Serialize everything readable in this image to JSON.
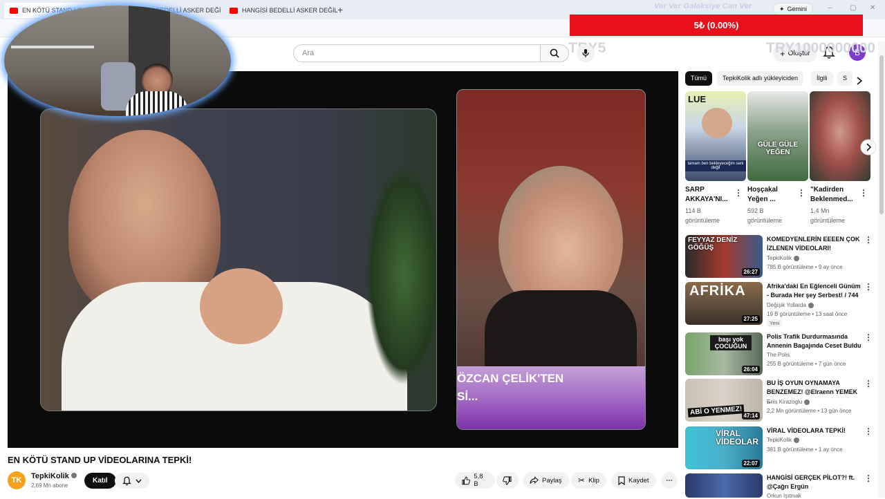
{
  "browser": {
    "tabs": [
      {
        "title": "EN KÖTÜ STAND UP VİDEOLARINA TEPKİ!"
      },
      {
        "title": "HANGİSİ BEDELLİ ASKER DEĞİL"
      },
      {
        "title": "HANGİSİ BEDELLİ ASKER DEĞİL"
      }
    ],
    "new_tab_glyph": "+",
    "gemini_label": "Gemini",
    "window_controls": [
      "–",
      "▢",
      "✕"
    ]
  },
  "stream_overlay": {
    "marquee_text": "Ver Ver Galaksiye Can Ver",
    "donation_bar_text": "5₺ (0.00%)",
    "left_counter": "TRY5",
    "right_counter": "TRY1000000000"
  },
  "header": {
    "search_placeholder": "Ara",
    "create_label": "Oluştur",
    "avatar_initial": "B"
  },
  "player": {
    "caption_line1": "ÖZCAN ÇELİK'TEN",
    "caption_line2": "Sİ..."
  },
  "video": {
    "title": "EN KÖTÜ STAND UP VİDEOLARINA TEPKİ!",
    "channel": "TepkiKolik",
    "channel_logo": "TK",
    "subscribers": "2,69 Mn abone",
    "join_label": "Katıl",
    "likes": "5,8 B",
    "share_label": "Paylaş",
    "clip_label": "Klip",
    "save_label": "Kaydet"
  },
  "sidebar": {
    "chips": [
      "Tümü",
      "TepkiKolik adlı yükleyiciden",
      "İlgili",
      "S"
    ],
    "shorts": [
      {
        "title_l1": "SARP",
        "title_l2": "AKKAYA'NI...",
        "views_l1": "114 B",
        "views_l2": "görüntüleme",
        "thumb_text": "tamam ben bekleyeceğim seni değil",
        "thumb_logo": "LUE"
      },
      {
        "title_l1": "Hoşçakal",
        "title_l2": "Yeğen ...",
        "views_l1": "592 B",
        "views_l2": "görüntüleme",
        "thumb_text": "GÜLE GÜLE YEĞEN"
      },
      {
        "title_l1": "\"Kadirden",
        "title_l2": "Beklenmed...",
        "views_l1": "1,4 Mn",
        "views_l2": "görüntüleme"
      }
    ],
    "videos": [
      {
        "title": "KOMEDYENLERİN EEEEN ÇOK İZLENEN VİDEOLARI!",
        "channel": "TepkiKolik",
        "meta": "785 B görüntüleme • 9 ay önce",
        "duration": "26:27",
        "thumb_text": "FEYYAZ DENİZ GÖĞÜŞ",
        "badge": ""
      },
      {
        "title": "Afrika'daki En Eğlenceli Günüm - Burada Her şey Serbest! / 744",
        "channel": "Değişik Yollarda",
        "meta": "19 B görüntüleme • 13 saat önce",
        "duration": "27:25",
        "thumb_text": "AFRİKA",
        "badge": "Yeni"
      },
      {
        "title": "Polis Trafik Durdurmasında Annenin Bagajında Ceset Buldu",
        "channel": "The Polis",
        "meta": "255 B görüntüleme • 7 gün önce",
        "duration": "26:04",
        "thumb_text": "başı yok ÇOCUĞUN",
        "badge": ""
      },
      {
        "title": "BU İŞ OYUN OYNAMAYA BENZEMEZ! @Elraenn YEMEK ...",
        "channel": "Enis Kirazoglu",
        "meta": "2,2 Mn görüntüleme • 13 gün önce",
        "duration": "47:14",
        "thumb_text": "ABİ O YENMEZ!",
        "badge": ""
      },
      {
        "title": "VİRAL VİDEOLARA TEPKİ!",
        "channel": "TepkiKolik",
        "meta": "381 B görüntüleme • 1 ay önce",
        "duration": "22:07",
        "thumb_text": "VİRAL VİDEOLAR",
        "badge": ""
      },
      {
        "title": "HANGİSİ GERÇEK PİLOT?! ft. @Çağrı Ergün",
        "channel": "Orkun Işıtmak",
        "meta": "",
        "duration": "",
        "thumb_text": "",
        "badge": ""
      }
    ]
  },
  "icons": {
    "search": "search-icon",
    "mic": "mic-icon",
    "bell": "bell-icon",
    "plus": "plus-icon",
    "like": "thumb-up-icon",
    "dislike": "thumb-down-icon",
    "share": "share-icon",
    "clip": "scissors-icon",
    "save": "bookmark-icon",
    "more": "more-horizontal-icon",
    "chevron": "chevron-right-icon"
  }
}
